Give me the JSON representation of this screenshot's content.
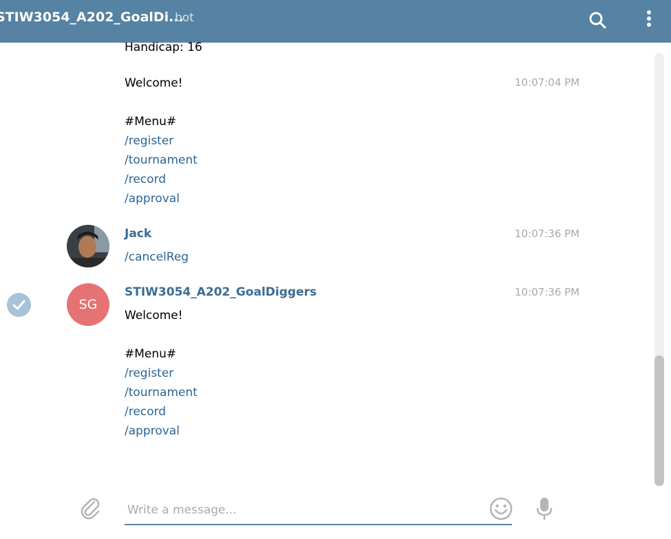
{
  "header": {
    "title": "STIW3054_A202_GoalDi...",
    "subtitle": "bot"
  },
  "messages": {
    "m0": {
      "lines": [
        "Handicap: 16",
        "Welcome!",
        "#Menu#"
      ],
      "commands": [
        "/register",
        "/tournament",
        "/record",
        "/approval"
      ],
      "time": "10:07:04 PM"
    },
    "m1": {
      "sender": "Jack",
      "command": "/cancelReg",
      "time": "10:07:36 PM"
    },
    "m2": {
      "sender": "STIW3054_A202_GoalDiggers",
      "avatar_initials": "SG",
      "lines": [
        "Welcome!",
        "#Menu#"
      ],
      "commands": [
        "/register",
        "/tournament",
        "/record",
        "/approval"
      ],
      "time": "10:07:36 PM"
    }
  },
  "composer": {
    "placeholder": "Write a message..."
  },
  "icons": {
    "search": "search-icon",
    "more": "more-vertical-icon",
    "attach": "paperclip-icon",
    "emoji": "smiley-icon",
    "mic": "microphone-icon",
    "check": "check-icon"
  },
  "colors": {
    "header_bg": "#5682a3",
    "link": "#2a6496",
    "sender_name": "#3b6c94",
    "timestamp": "#a9a9a9",
    "avatar_sg": "#e57373"
  }
}
